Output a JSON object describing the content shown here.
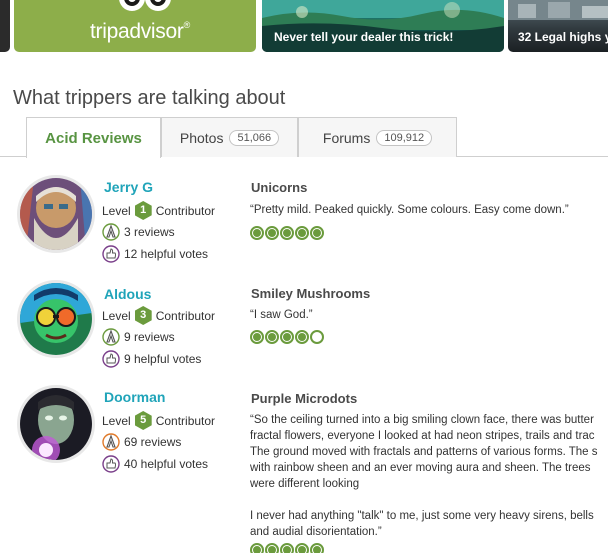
{
  "ads": {
    "brand_logo": "tripadvisor",
    "tiles": [
      {
        "caption": "Never tell your dealer this trick!"
      },
      {
        "caption": "32 Legal highs y"
      }
    ]
  },
  "section_title": "What trippers are talking about",
  "tabs": [
    {
      "label": "Acid Reviews",
      "count": ""
    },
    {
      "label": "Photos",
      "count": "51,066"
    },
    {
      "label": "Forums",
      "count": "109,912"
    }
  ],
  "reviews": [
    {
      "name": "Jerry G",
      "level_prefix": "Level",
      "level": "1",
      "level_suffix": "Contributor",
      "reviews_count": "3 reviews",
      "helpful_votes": "12 helpful votes",
      "title": "Unicorns",
      "quote_lines": [
        "“Pretty mild. Peaked quickly. Some colours. Easy come down.”"
      ],
      "rating": 5
    },
    {
      "name": "Aldous",
      "level_prefix": "Level",
      "level": "3",
      "level_suffix": "Contributor",
      "reviews_count": "9 reviews",
      "helpful_votes": "9 helpful votes",
      "title": "Smiley Mushrooms",
      "quote_lines": [
        "“I saw God.”"
      ],
      "rating": 4
    },
    {
      "name": "Doorman",
      "level_prefix": "Level",
      "level": "5",
      "level_suffix": "Contributor",
      "reviews_count": "69 reviews",
      "helpful_votes": "40 helpful votes",
      "title": "Purple Microdots",
      "quote_lines": [
        "“So the ceiling turned into a big smiling clown face, there was butter",
        "fractal flowers, everyone I looked at had neon stripes, trails and trac",
        "The ground moved with fractals and patterns of various forms. The s",
        "with rainbow sheen and an ever moving aura and sheen. The trees",
        "were different looking",
        "",
        "I never had anything \"talk\" to me, just some very heavy sirens, bells",
        "and audial disorientation.”"
      ],
      "rating": 5
    }
  ],
  "colors": {
    "brand_green": "#8dae4a",
    "tab_active_green": "#589442",
    "reviewer_name_teal": "#20a4b9",
    "bubble_green": "#6b9b3d"
  }
}
